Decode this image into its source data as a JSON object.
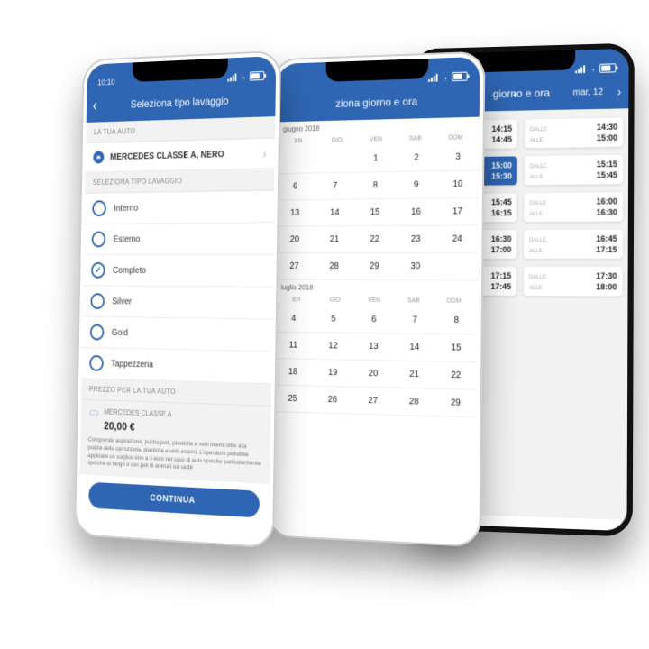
{
  "statusbar": {
    "time": "10:10"
  },
  "screen1": {
    "title": "Seleziona tipo lavaggio",
    "sec_auto": "LA TUA AUTO",
    "car": "MERCEDES CLASSE A, NERO",
    "sec_wash": "SELEZIONA TIPO LAVAGGIO",
    "wash": [
      {
        "label": "Interno",
        "checked": false
      },
      {
        "label": "Esterno",
        "checked": false
      },
      {
        "label": "Completo",
        "checked": true
      },
      {
        "label": "Silver",
        "checked": false
      },
      {
        "label": "Gold",
        "checked": false
      },
      {
        "label": "Tappezzeria",
        "checked": false
      }
    ],
    "sec_price": "PREZZO PER LA TUA AUTO",
    "price_car": "MERCEDES CLASSE A",
    "price": "20,00 €",
    "desc": "Comprende aspirazione, pulizia pelli, plastiche e vetri interni oltre alla pulizia della carrozzeria, plastiche e vetri esterni.\nL'operatore potrebbe applicare un surplus sino a 3 euro nel caso di auto sporche particolarmente sporche di fango o con peli di animali sui sedili",
    "cta": "CONTINUA"
  },
  "screen2": {
    "title_frag": "ziona giorno e ora",
    "month1": "giugno 2018",
    "month2": "luglio 2018",
    "daycols": [
      "ER",
      "GIO",
      "VEN",
      "SAB",
      "DOM"
    ],
    "rows_m1": [
      [
        "",
        "",
        "1",
        "2",
        "3"
      ],
      [
        "6",
        "7",
        "8",
        "9",
        "10"
      ],
      [
        "13",
        "14",
        "15",
        "16",
        "17"
      ],
      [
        "20",
        "21",
        "22",
        "23",
        "24"
      ],
      [
        "27",
        "28",
        "29",
        "30",
        ""
      ]
    ],
    "rows_m2": [
      [
        "4",
        "5",
        "6",
        "7",
        "8"
      ],
      [
        "11",
        "12",
        "13",
        "14",
        "15"
      ],
      [
        "18",
        "19",
        "20",
        "21",
        "22"
      ],
      [
        "25",
        "26",
        "27",
        "28",
        "29"
      ]
    ]
  },
  "screen3": {
    "title_frag": "giorno e ora",
    "date": "mar, 12",
    "label_from": "DALLE",
    "label_to": "ALLE",
    "col1": [
      {
        "a": "14:15",
        "b": "14:45",
        "sel": false
      },
      {
        "a": "15:00",
        "b": "15:30",
        "sel": true
      },
      {
        "a": "15:45",
        "b": "16:15",
        "sel": false
      },
      {
        "a": "16:30",
        "b": "17:00",
        "sel": false
      },
      {
        "a": "17:15",
        "b": "17:45",
        "sel": false
      }
    ],
    "col2": [
      {
        "a": "14:30",
        "b": "15:00",
        "sel": false
      },
      {
        "a": "15:15",
        "b": "15:45",
        "sel": false
      },
      {
        "a": "16:00",
        "b": "16:30",
        "sel": false
      },
      {
        "a": "16:45",
        "b": "17:15",
        "sel": false
      },
      {
        "a": "17:30",
        "b": "18:00",
        "sel": false
      }
    ]
  }
}
